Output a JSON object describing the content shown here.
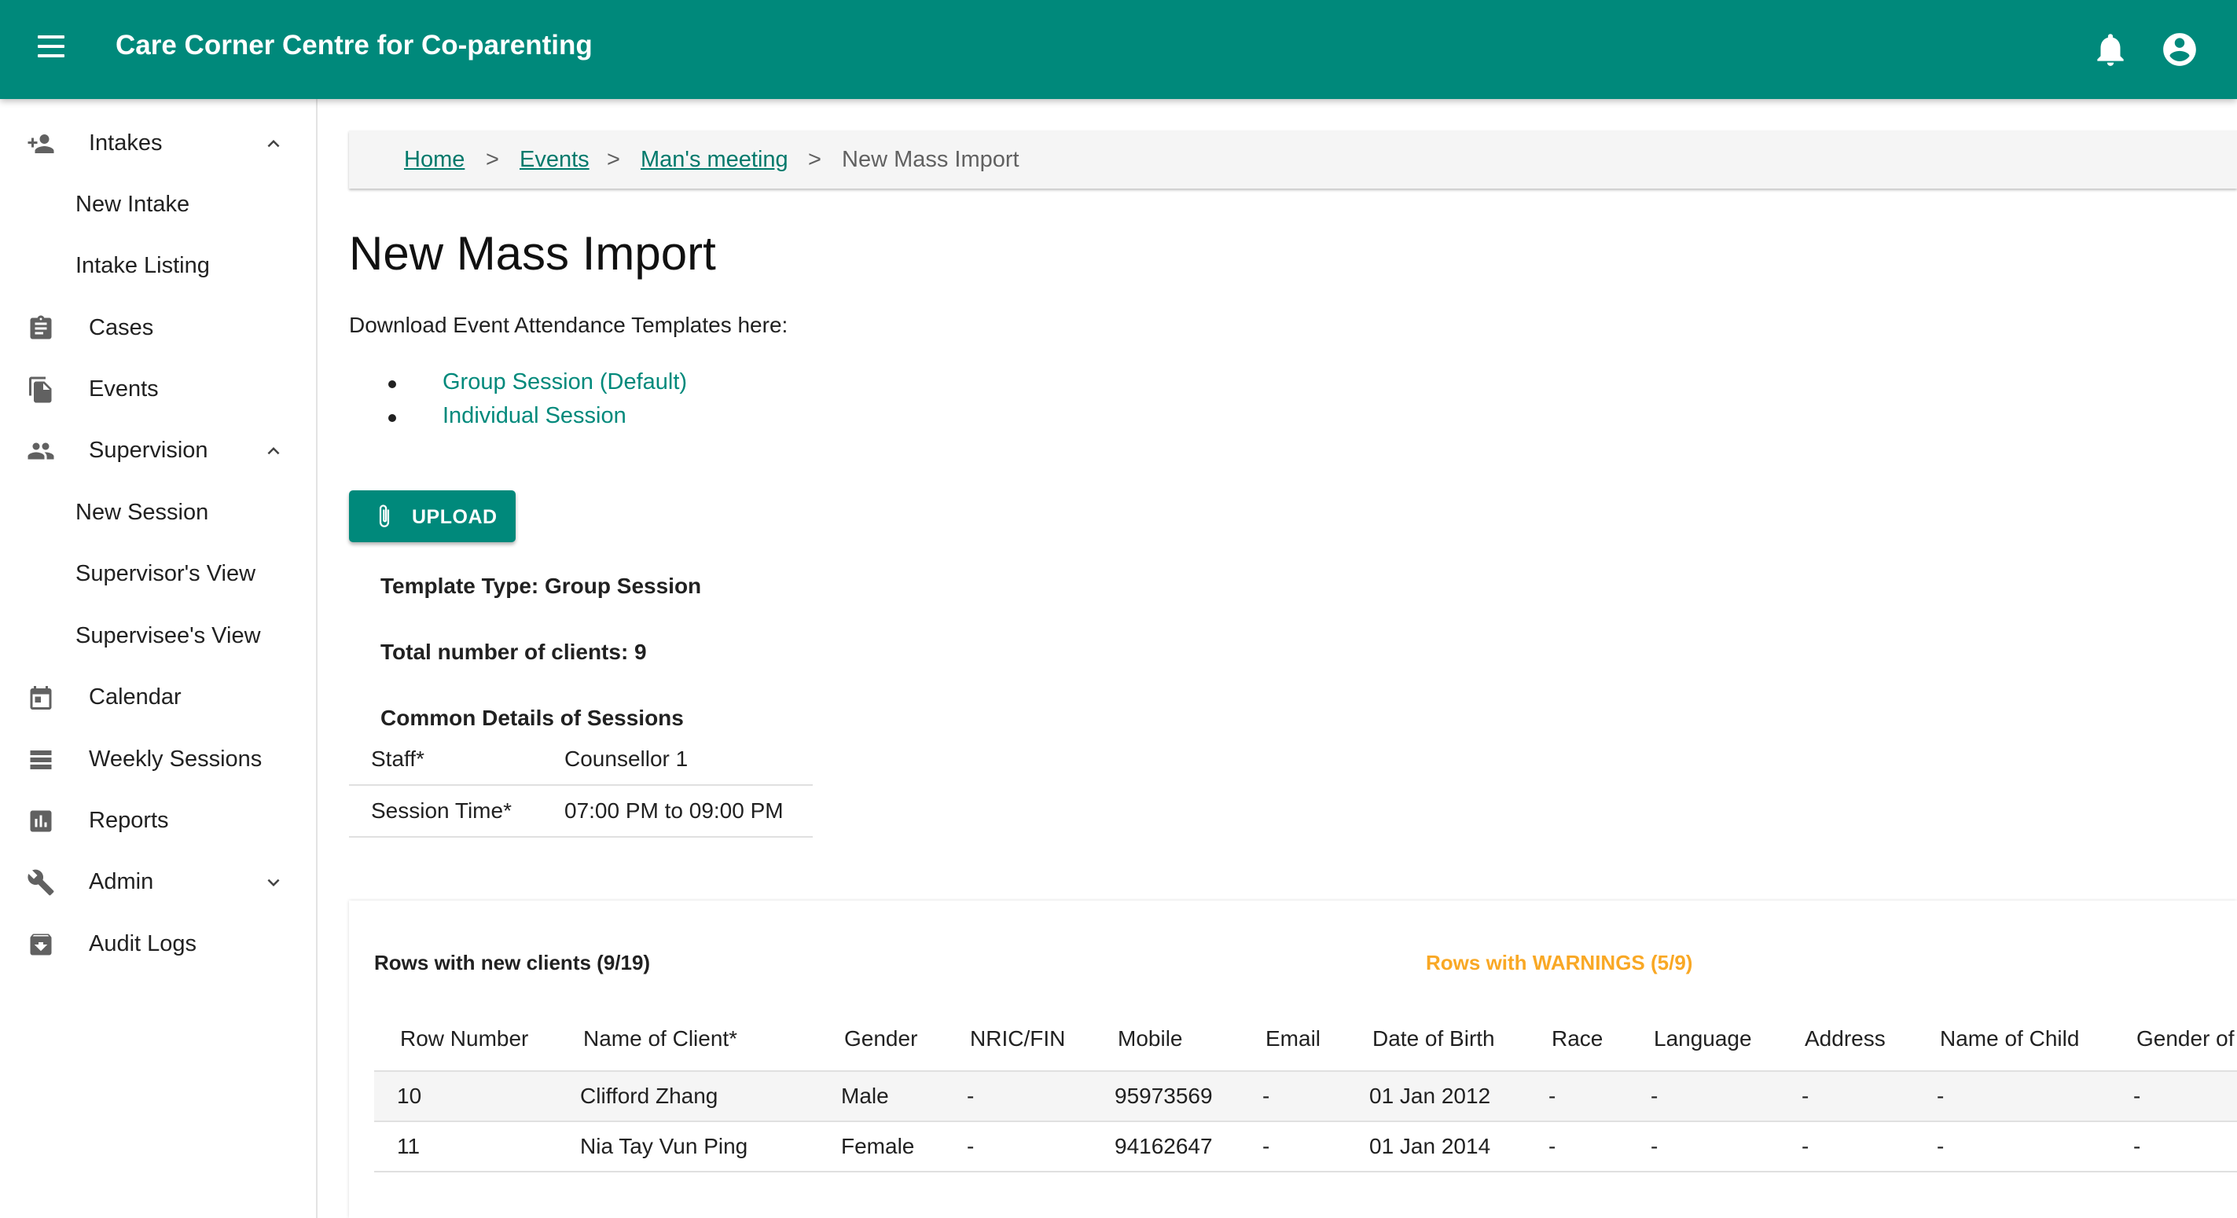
{
  "app": {
    "title": "Care Corner Centre for Co-parenting",
    "accent_color": "#00897b",
    "icons": {
      "menu": "menu-icon",
      "notifications": "bell-icon",
      "account": "account-circle-icon"
    }
  },
  "sidebar": {
    "items": [
      {
        "label": "Intakes",
        "icon": "person-add-icon",
        "expanded": true
      },
      {
        "label": "New Intake"
      },
      {
        "label": "Intake Listing"
      },
      {
        "label": "Cases",
        "icon": "clipboard-icon"
      },
      {
        "label": "Events",
        "icon": "file-copy-icon"
      },
      {
        "label": "Supervision",
        "icon": "people-icon",
        "expanded": true
      },
      {
        "label": "New Session"
      },
      {
        "label": "Supervisor's View"
      },
      {
        "label": "Supervisee's View"
      },
      {
        "label": "Calendar",
        "icon": "calendar-icon"
      },
      {
        "label": "Weekly Sessions",
        "icon": "view-list-icon"
      },
      {
        "label": "Reports",
        "icon": "bar-chart-icon"
      },
      {
        "label": "Admin",
        "icon": "wrench-icon",
        "expanded": false
      },
      {
        "label": "Audit Logs",
        "icon": "archive-icon"
      }
    ]
  },
  "breadcrumb": {
    "items": [
      "Home",
      "Events",
      "Man's meeting"
    ],
    "current": "New Mass Import",
    "separator": ">"
  },
  "page": {
    "title": "New Mass Import",
    "intro": "Download Event Attendance Templates here:",
    "template_links": [
      "Group Session (Default)",
      "Individual Session"
    ],
    "upload_label": "UPLOAD",
    "template_type": "Template Type: Group Session",
    "total_clients": "Total number of clients: 9",
    "common_details_heading": "Common Details of Sessions",
    "common_details": [
      {
        "key": "Staff*",
        "value": "Counsellor 1"
      },
      {
        "key": "Session Time*",
        "value": "07:00 PM to 09:00 PM"
      }
    ]
  },
  "results": {
    "tab_new_clients": "Rows with new clients (9/19)",
    "tab_warnings": "Rows with WARNINGS (5/9)",
    "warning_color": "#f9a825",
    "columns": [
      "Row Number",
      "Name of Client*",
      "Gender",
      "NRIC/FIN",
      "Mobile",
      "Email",
      "Date of Birth",
      "Race",
      "Language",
      "Address",
      "Name of Child",
      "Gender of"
    ],
    "rows": [
      [
        "10",
        "Clifford Zhang",
        "Male",
        "-",
        "95973569",
        "-",
        "01 Jan 2012",
        "-",
        "-",
        "-",
        "-",
        "-"
      ],
      [
        "11",
        "Nia Tay Vun Ping",
        "Female",
        "-",
        "94162647",
        "-",
        "01 Jan 2014",
        "-",
        "-",
        "-",
        "-",
        "-"
      ]
    ]
  }
}
